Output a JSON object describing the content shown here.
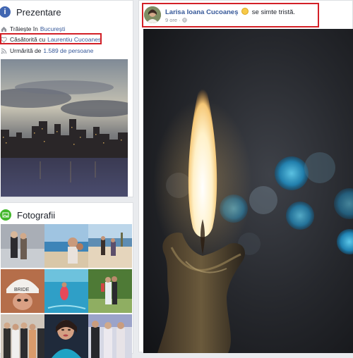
{
  "intro": {
    "title": "Prezentare",
    "lives_prefix": "Trăiește în",
    "lives_city": "București",
    "married_prefix": "Căsătorită cu",
    "married_name": "Laurentiu Cucoanes",
    "followed_prefix": "Urmărită de",
    "followers": "1.589 de persoane"
  },
  "photos": {
    "title": "Fotografii",
    "thumbnails": [
      "couple-on-stairs",
      "beach-selfie",
      "people-on-beach",
      "white-cap-girl",
      "pool-float",
      "wedding-couple-garden",
      "wedding-group",
      "woman-blue-dress",
      "event-couple"
    ]
  },
  "post": {
    "author": "Larisa Ioana Cucoaneș",
    "feeling": "se simte tristă.",
    "time": "9 ore",
    "privacy_icon": "globe-icon"
  },
  "colors": {
    "accent": "#4267b2",
    "link": "#365899",
    "highlight": "#d32027",
    "photos_icon": "#42b72a"
  }
}
